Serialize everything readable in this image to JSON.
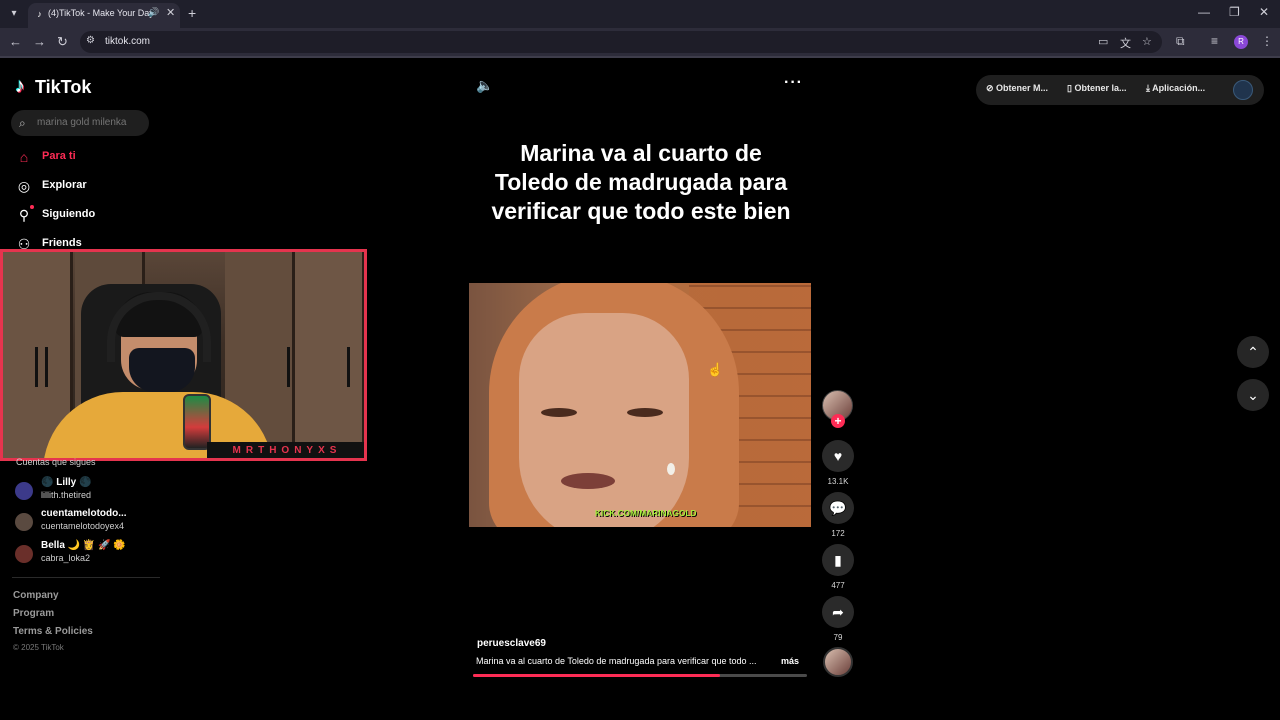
{
  "browser": {
    "tab_title": "(4)TikTok - Make Your Day",
    "url": "tiktok.com",
    "profile_initial": "R"
  },
  "sidebar": {
    "logo": "TikTok",
    "search_placeholder": "marina gold milenka",
    "nav": [
      {
        "label": "Para ti",
        "active": true
      },
      {
        "label": "Explorar"
      },
      {
        "label": "Siguiendo"
      },
      {
        "label": "Friends"
      }
    ],
    "following_title": "Cuentas que sigues",
    "accounts": [
      {
        "name": "🌑 Lilly 🌑",
        "username": "lillith.thetired"
      },
      {
        "name": "cuentamelotodo...",
        "username": "cuentamelotodoyex4"
      },
      {
        "name": "Bella 🌙 👸 🚀 🌼",
        "username": "cabra_loka2"
      }
    ],
    "footer": [
      "Company",
      "Program",
      "Terms & Policies"
    ],
    "copyright": "© 2025 TikTok"
  },
  "webcam": {
    "streamer_name": "MRTHONYXS"
  },
  "video": {
    "caption": "Marina va al cuarto de Toledo de madrugada para verificar que todo este bien",
    "watermark": "KICK.COM/MARINAGOLD",
    "author": "peruesclave69",
    "description": "Marina va al cuarto de Toledo de madrugada para verificar que todo ...",
    "more_label": "más",
    "progress": 0.74,
    "likes": "13.1K",
    "comments": "172",
    "saves": "477",
    "shares": "79"
  },
  "top_bar": {
    "items": [
      "Obtener M...",
      "Obtener la...",
      "Aplicación..."
    ]
  },
  "colors": {
    "accent": "#fe2c55",
    "chrome_bg": "#2d2c3a",
    "background": "#000000"
  }
}
